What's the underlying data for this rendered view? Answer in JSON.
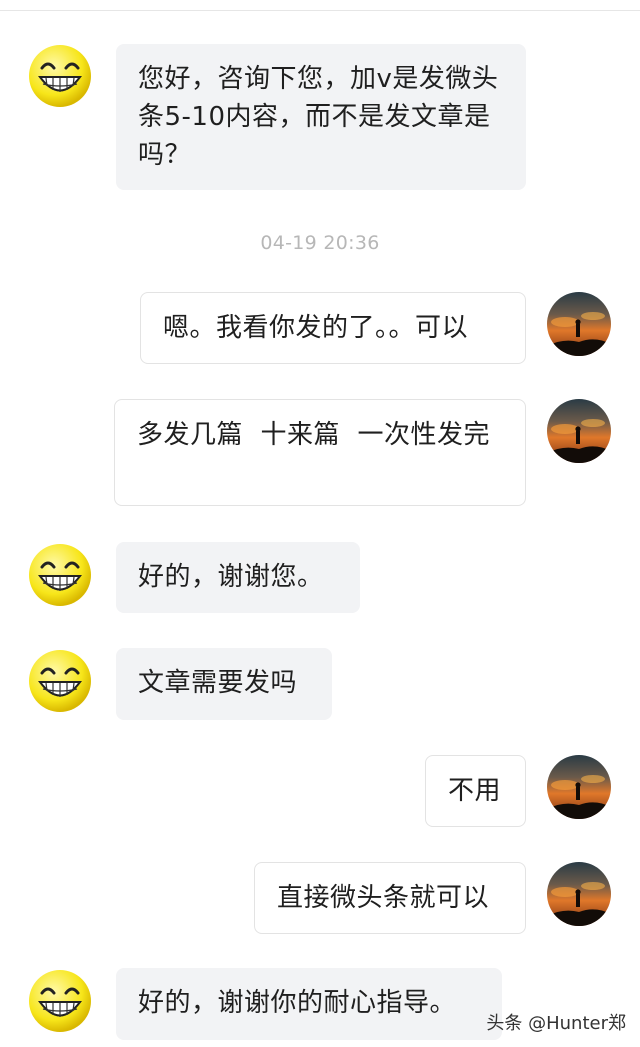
{
  "chat": {
    "timestamp": "04-19 20:36",
    "messages": [
      {
        "side": "in",
        "text": "您好，咨询下您，加v是发微头条5-10内容，而不是发文章是吗？"
      },
      {
        "side": "out",
        "text": "嗯。我看你发的了。。可以"
      },
      {
        "side": "out",
        "text": "多发几篇  十来篇  一次性发完"
      },
      {
        "side": "in",
        "text": "好的，谢谢您。"
      },
      {
        "side": "in",
        "text": "文章需要发吗"
      },
      {
        "side": "out",
        "text": "不用"
      },
      {
        "side": "out",
        "text": "直接微头条就可以"
      },
      {
        "side": "in",
        "text": "好的，谢谢你的耐心指导。"
      }
    ]
  },
  "avatars": {
    "left": "smiling-emoji-icon",
    "right": "sunset-silhouette-avatar"
  },
  "watermark": "头条 @Hunter郑",
  "colors": {
    "incoming_bubble": "#f2f3f5",
    "outgoing_bubble": "#ffffff",
    "timestamp": "#b7b7b7"
  }
}
